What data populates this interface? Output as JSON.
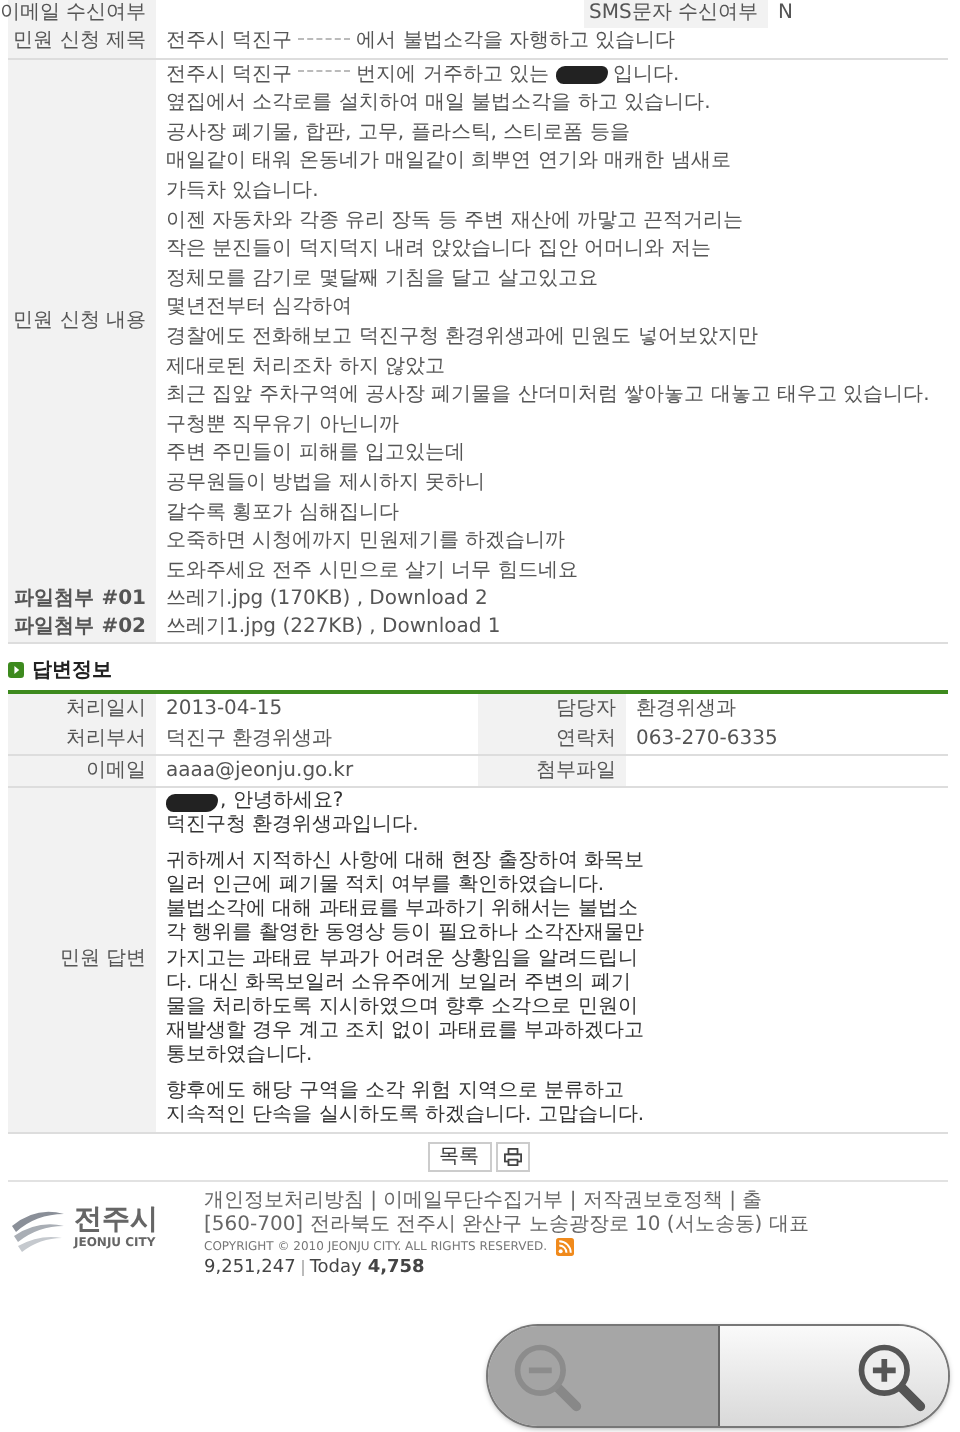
{
  "application": {
    "top_row": [
      {
        "label": "이메일 수신여부"
      },
      {
        "label": "SMS문자 수신여부",
        "value": "N"
      }
    ],
    "title": {
      "label": "민원 신청 제목",
      "parts": [
        {
          "kind": "text",
          "text": "전주시 덕진구"
        },
        {
          "kind": "blur"
        },
        {
          "kind": "text",
          "text": "에서 불법소각을 자행하고 있습니다"
        }
      ]
    },
    "content": {
      "label": "민원 신청 내용",
      "lines": [
        [
          {
            "kind": "text",
            "text": "전주시 덕진구"
          },
          {
            "kind": "blur"
          },
          {
            "kind": "text",
            "text": "번지에 거주하고 있는"
          },
          {
            "kind": "blackout"
          },
          {
            "kind": "text",
            "text": "입니다."
          }
        ],
        [
          {
            "kind": "text",
            "text": "옆집에서 소각로를 설치하여 매일 불법소각을 하고 있습니다."
          }
        ],
        [
          {
            "kind": "text",
            "text": "공사장 폐기물, 합판, 고무, 플라스틱, 스티로폼 등을"
          }
        ],
        [
          {
            "kind": "text",
            "text": "매일같이 태워 온동네가 매일같이 희뿌연 연기와 매캐한 냄새로"
          }
        ],
        [
          {
            "kind": "text",
            "text": "가득차 있습니다."
          }
        ],
        [
          {
            "kind": "text",
            "text": "이젠 자동차와 각종 유리 장독 등 주변 재산에 까맣고 끈적거리는"
          }
        ],
        [
          {
            "kind": "text",
            "text": "작은 분진들이 덕지덕지 내려 앉았습니다 집안 어머니와 저는"
          }
        ],
        [
          {
            "kind": "text",
            "text": "정체모를 감기로 몇달째 기침을 달고 살고있고요"
          }
        ],
        [
          {
            "kind": "text",
            "text": "몇년전부터 심각하여"
          }
        ],
        [
          {
            "kind": "text",
            "text": "경찰에도 전화해보고 덕진구청 환경위생과에 민원도 넣어보았지만"
          }
        ],
        [
          {
            "kind": "text",
            "text": "제대로된 처리조차 하지 않았고"
          }
        ],
        [
          {
            "kind": "text",
            "text": "최근 집앞 주차구역에 공사장 폐기물을 산더미처럼 쌓아놓고 대놓고 태우고 있습니다."
          }
        ],
        [
          {
            "kind": "text",
            "text": "구청뿐 직무유기 아닌니까"
          }
        ],
        [
          {
            "kind": "text",
            "text": "주변 주민들이 피해를 입고있는데"
          }
        ],
        [
          {
            "kind": "text",
            "text": "공무원들이 방법을 제시하지 못하니"
          }
        ],
        [
          {
            "kind": "text",
            "text": "갈수록 횡포가 심해집니다"
          }
        ],
        [
          {
            "kind": "text",
            "text": "오죽하면 시청에까지 민원제기를 하겠습니까"
          }
        ],
        [
          {
            "kind": "text",
            "text": "도와주세요 전주 시민으로 살기 너무 힘드네요"
          }
        ]
      ]
    },
    "attachments": [
      {
        "label": "파일첨부 #01",
        "file": "쓰레기.jpg (170KB) , Download 2"
      },
      {
        "label": "파일첨부 #02",
        "file": "쓰레기1.jpg (227KB) , Download 1"
      }
    ]
  },
  "answer": {
    "heading": "답변정보",
    "fields": [
      {
        "label": "처리일시",
        "value": "2013-04-15"
      },
      {
        "label": "담당자",
        "value": "환경위생과"
      },
      {
        "label": "처리부서",
        "value": "덕진구 환경위생과"
      },
      {
        "label": "연락처",
        "value": "063-270-6335"
      },
      {
        "label": "이메일",
        "value": "aaaa@jeonju.go.kr"
      },
      {
        "label": "첨부파일"
      }
    ],
    "reply_label": "민원 답변",
    "paragraphs": [
      [
        [
          {
            "kind": "blackout"
          },
          {
            "kind": "text",
            "text": ", 안녕하세요?"
          }
        ],
        [
          {
            "kind": "text",
            "text": "덕진구청 환경위생과입니다."
          }
        ]
      ],
      [
        [
          {
            "kind": "text",
            "text": "귀하께서 지적하신 사항에 대해 현장 출장하여 화목보"
          }
        ],
        [
          {
            "kind": "text",
            "text": "일러 인근에 폐기물 적치 여부를 확인하였습니다."
          }
        ],
        [
          {
            "kind": "text",
            "text": "불법소각에 대해 과태료를 부과하기 위해서는 불법소"
          }
        ],
        [
          {
            "kind": "text",
            "text": "각 행위를 촬영한 동영상 등이 필요하나 소각잔재물만"
          }
        ],
        [
          {
            "kind": "text",
            "text": "가지고는 과태료 부과가 어려운 상황임을 알려드립니"
          }
        ],
        [
          {
            "kind": "text",
            "text": "다. 대신 화목보일러 소유주에게 보일러 주변의 폐기"
          }
        ],
        [
          {
            "kind": "text",
            "text": "물을 처리하도록 지시하였으며 향후 소각으로 민원이"
          }
        ],
        [
          {
            "kind": "text",
            "text": "재발생할 경우 계고 조치 없이 과태료를 부과하겠다고"
          }
        ],
        [
          {
            "kind": "text",
            "text": "통보하였습니다."
          }
        ]
      ],
      [
        [
          {
            "kind": "text",
            "text": "향후에도 해당 구역을 소각 위험 지역으로 분류하고"
          }
        ],
        [
          {
            "kind": "text",
            "text": "지속적인 단속을 실시하도록 하겠습니다. 고맙습니다."
          }
        ]
      ]
    ]
  },
  "list_button": "목록",
  "footer": {
    "logo_name": "전주시",
    "logo_sub": "JEONJU CITY",
    "links": "개인정보처리방침 | 이메일무단수집거부 | 저작권보호정책 | 출",
    "address": "[560-700] 전라북도 전주시 완산구 노송광장로 10 (서노송동) 대표",
    "copyright": "COPYRIGHT © 2010 JEONJU CITY. ALL RIGHTS RESERVED.",
    "total": "9,251,247",
    "today_label": "Today",
    "today": "4,758"
  },
  "zoom_controls": [
    {
      "kind": "zoom-out",
      "selected": true
    },
    {
      "kind": "zoom-in",
      "selected": false
    }
  ]
}
